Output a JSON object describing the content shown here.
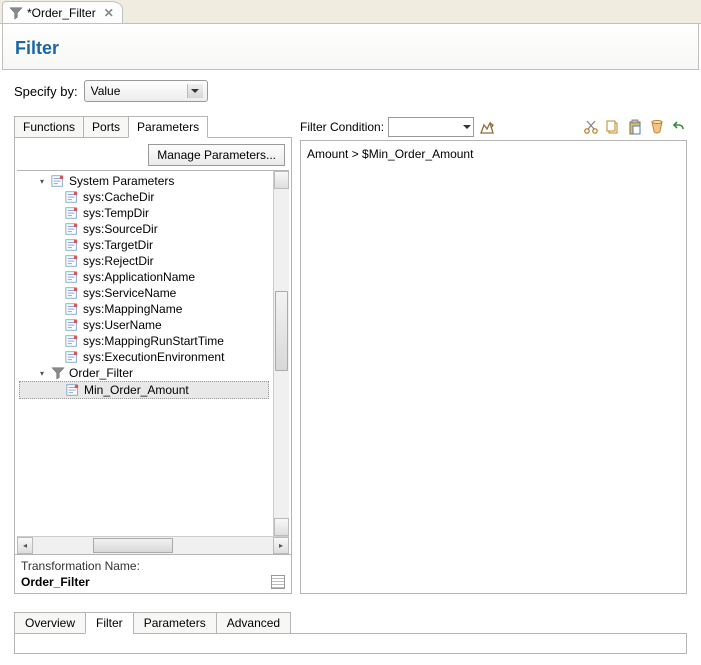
{
  "topTab": {
    "label": "*Order_Filter"
  },
  "title": "Filter",
  "specifyBy": {
    "label": "Specify by:",
    "value": "Value"
  },
  "leftTabs": [
    "Functions",
    "Ports",
    "Parameters"
  ],
  "activeLeftTab": "Parameters",
  "manageBtn": "Manage Parameters...",
  "tree": {
    "root1": {
      "label": "System Parameters",
      "children": [
        "sys:CacheDir",
        "sys:TempDir",
        "sys:SourceDir",
        "sys:TargetDir",
        "sys:RejectDir",
        "sys:ApplicationName",
        "sys:ServiceName",
        "sys:MappingName",
        "sys:UserName",
        "sys:MappingRunStartTime",
        "sys:ExecutionEnvironment"
      ]
    },
    "root2": {
      "label": "Order_Filter",
      "children": [
        "Min_Order_Amount"
      ]
    }
  },
  "transformationName": {
    "label": "Transformation Name:",
    "value": "Order_Filter"
  },
  "filterCondition": {
    "label": "Filter Condition:",
    "expression": "Amount > $Min_Order_Amount"
  },
  "bottomTabs": [
    "Overview",
    "Filter",
    "Parameters",
    "Advanced"
  ],
  "activeBottomTab": "Filter"
}
